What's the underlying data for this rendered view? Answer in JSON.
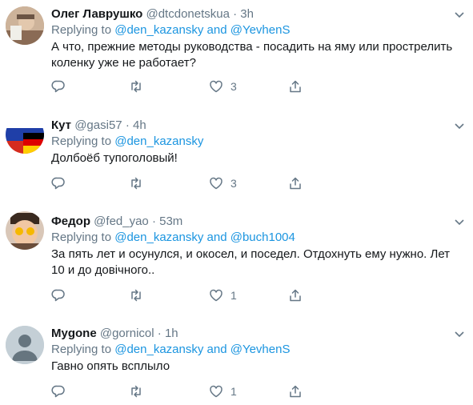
{
  "tweets": [
    {
      "name": "Олег Лаврушко",
      "handle": "@dtcdonetskua",
      "separator": "·",
      "time": "3h",
      "replying_prefix": "Replying to",
      "mentions": [
        "@den_kazansky",
        "@YevhenS"
      ],
      "mention_joiner": "and",
      "text": "А что, прежние методы руководства - посадить на яму или прострелить коленку уже не работает?",
      "counts": {
        "reply": "",
        "retweet": "",
        "like": "3"
      }
    },
    {
      "name": "Кут",
      "handle": "@gasi57",
      "separator": "·",
      "time": "4h",
      "replying_prefix": "Replying to",
      "mentions": [
        "@den_kazansky"
      ],
      "text": "Долбоёб тупоголовый!",
      "counts": {
        "reply": "",
        "retweet": "",
        "like": "3"
      }
    },
    {
      "name": "Федор",
      "handle": "@fed_yao",
      "separator": "·",
      "time": "53m",
      "replying_prefix": "Replying to",
      "mentions": [
        "@den_kazansky",
        "@buch1004"
      ],
      "mention_joiner": "and",
      "text": "За пять лет и осунулся, и окосел, и поседел. Отдохнуть ему нужно. Лет 10 и до довічного..",
      "counts": {
        "reply": "",
        "retweet": "",
        "like": "1"
      }
    },
    {
      "name": "Mygone",
      "handle": "@gornicol",
      "separator": "·",
      "time": "1h",
      "replying_prefix": "Replying to",
      "mentions": [
        "@den_kazansky",
        "@YevhenS"
      ],
      "mention_joiner": "and",
      "text": "Гавно опять всплыло",
      "counts": {
        "reply": "",
        "retweet": "",
        "like": "1"
      }
    }
  ],
  "colors": {
    "link": "#1b95e0",
    "muted": "#657786",
    "divider": "#e6ecf0"
  },
  "icons": [
    "reply-icon",
    "retweet-icon",
    "like-icon",
    "share-icon",
    "chevron-down-icon"
  ]
}
